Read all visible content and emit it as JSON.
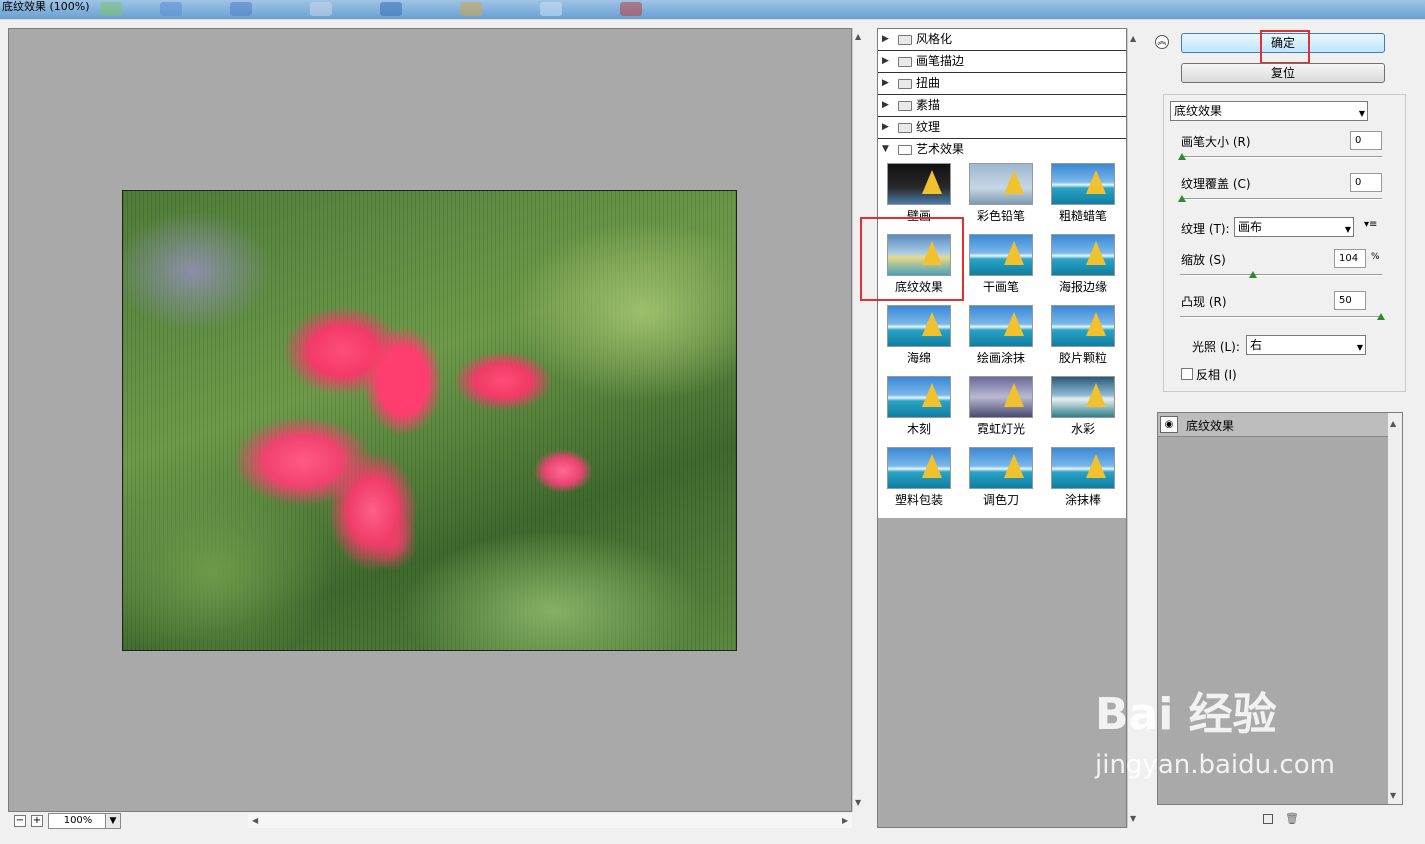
{
  "window": {
    "title": "底纹效果 (100%)"
  },
  "zoom": {
    "value": "100%",
    "minus_icon": "minus-icon",
    "plus_icon": "plus-icon"
  },
  "gallery": {
    "categories": [
      {
        "label": "风格化",
        "expanded": false
      },
      {
        "label": "画笔描边",
        "expanded": false
      },
      {
        "label": "扭曲",
        "expanded": false
      },
      {
        "label": "素描",
        "expanded": false
      },
      {
        "label": "纹理",
        "expanded": false
      },
      {
        "label": "艺术效果",
        "expanded": true
      }
    ],
    "filters": [
      "壁画",
      "彩色铅笔",
      "粗糙蜡笔",
      "底纹效果",
      "干画笔",
      "海报边缘",
      "海绵",
      "绘画涂抹",
      "胶片颗粒",
      "木刻",
      "霓虹灯光",
      "水彩",
      "塑料包装",
      "调色刀",
      "涂抹棒"
    ],
    "selected": "底纹效果"
  },
  "buttons": {
    "ok": "确定",
    "reset": "复位"
  },
  "settings": {
    "filter_select": "底纹效果",
    "brush_size_label": "画笔大小 (R)",
    "brush_size_value": "0",
    "texture_coverage_label": "纹理覆盖 (C)",
    "texture_coverage_value": "0",
    "texture_label": "纹理 (T):",
    "texture_value": "画布",
    "scaling_label": "缩放 (S)",
    "scaling_value": "104",
    "scaling_unit": "%",
    "relief_label": "凸现 (R)",
    "relief_value": "50",
    "light_label": "光照 (L):",
    "light_value": "右",
    "invert_label": "反相 (I)",
    "invert_checked": false
  },
  "layers": {
    "items": [
      "底纹效果"
    ]
  },
  "watermark": {
    "main": "Bai 经验",
    "sub": "jingyan.baidu.com"
  },
  "colors": {
    "highlight": "#e03030",
    "preview_bg": "#a9a9a9",
    "ok_accent": "#3c7fb1"
  }
}
